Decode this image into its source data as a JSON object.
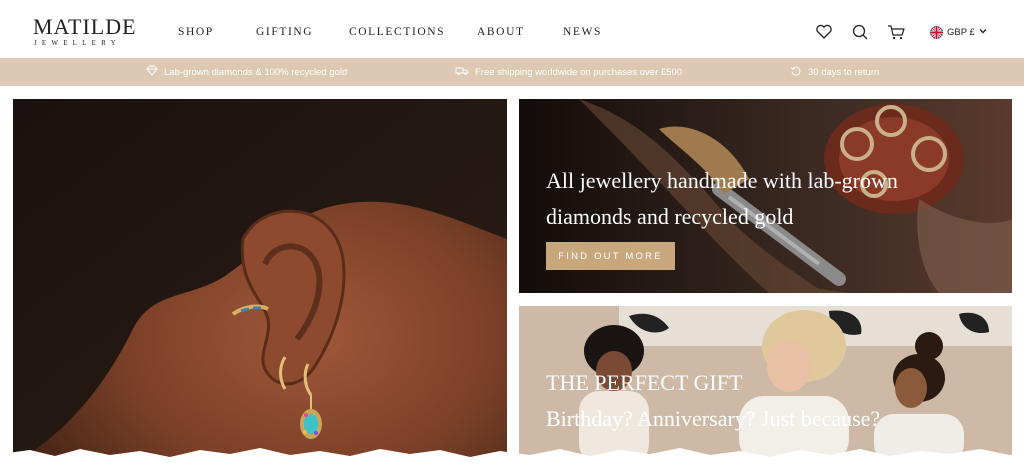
{
  "header": {
    "logo_main": "MATILDE",
    "logo_sub": "JEWELLERY",
    "nav": [
      "SHOP",
      "GIFTING",
      "COLLECTIONS",
      "ABOUT",
      "NEWS"
    ],
    "currency": "GBP £",
    "icons": [
      "heart-icon",
      "search-icon",
      "cart-icon",
      "uk-flag-icon",
      "chevron-down-icon"
    ]
  },
  "promo": {
    "items": [
      "Lab-grown diamonds & 100% recycled gold",
      "Free shipping worldwide on purchases over £500",
      "30 days to return"
    ],
    "background": "#dcc8b3"
  },
  "hero": {
    "tools_tile": {
      "headline_line1": "All jewellery handmade with lab-grown",
      "headline_line2": "diamonds and recycled gold",
      "cta_label": "FIND OUT MORE",
      "cta_color": "#c8a77c"
    },
    "gift_tile": {
      "title": "THE PERFECT GIFT",
      "subtitle": "Birthday? Anniversary? Just because?"
    }
  }
}
